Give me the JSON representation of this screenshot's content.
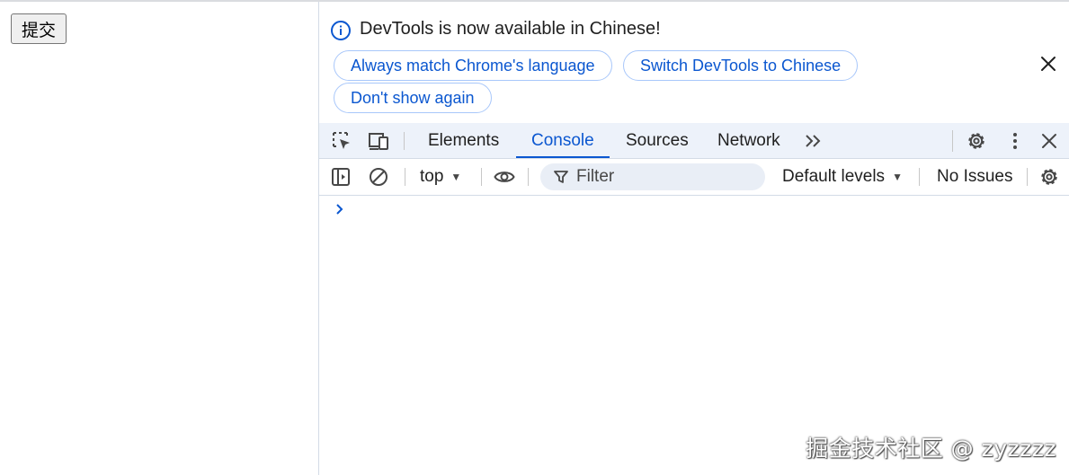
{
  "page": {
    "submit_label": "提交"
  },
  "infobar": {
    "message": "DevTools is now available in Chinese!",
    "buttons": [
      {
        "label": "Always match Chrome's language"
      },
      {
        "label": "Switch DevTools to Chinese"
      },
      {
        "label": "Don't show again"
      }
    ],
    "icon": "info-icon"
  },
  "tabbar": {
    "tabs": [
      {
        "label": "Elements"
      },
      {
        "label": "Console",
        "active": true
      },
      {
        "label": "Sources"
      },
      {
        "label": "Network"
      }
    ],
    "icons": [
      "inspect-element-icon",
      "device-toggle-icon",
      "more-tabs-icon",
      "settings-icon",
      "more-options-icon",
      "close-icon"
    ]
  },
  "toolbar": {
    "context": "top",
    "filter_placeholder": "Filter",
    "levels": "Default levels",
    "issues": "No Issues",
    "icons": [
      "sidebar-toggle-icon",
      "clear-console-icon",
      "eye-icon",
      "filter-icon",
      "console-settings-icon"
    ]
  },
  "watermark": "掘金技术社区 @ zyzzzz",
  "colors": {
    "accent": "#0b57d0",
    "tabbar_bg": "#edf2fa",
    "pill_border": "#a8c7fa",
    "filter_bg": "#e9eef6"
  }
}
